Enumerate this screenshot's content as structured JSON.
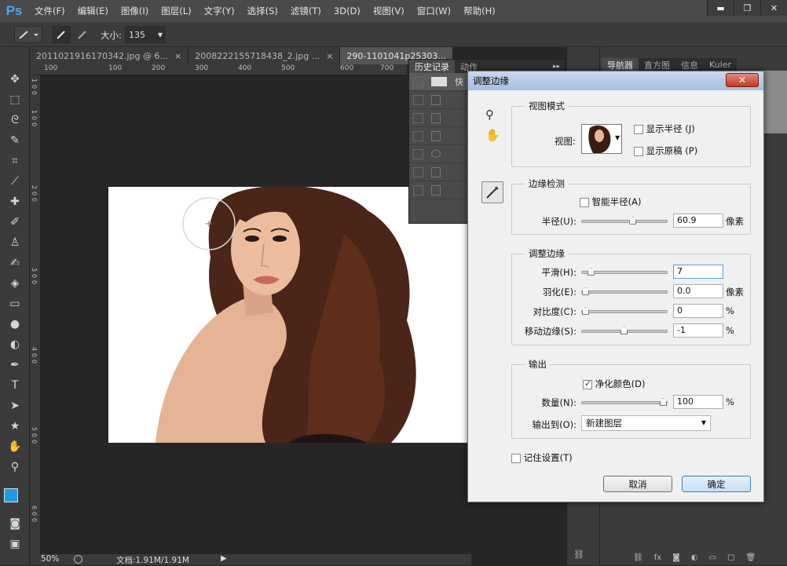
{
  "app": {
    "logo": "Ps"
  },
  "menu": [
    "文件(F)",
    "编辑(E)",
    "图像(I)",
    "图层(L)",
    "文字(Y)",
    "选择(S)",
    "滤镜(T)",
    "3D(D)",
    "视图(V)",
    "窗口(W)",
    "帮助(H)"
  ],
  "window_controls": {
    "minimize": "▬",
    "restore": "❐",
    "close": "✕"
  },
  "options": {
    "size_label": "大小:",
    "size_value": "135"
  },
  "tabs": [
    {
      "label": "2011021916170342.jpg @ 6...",
      "close": "×"
    },
    {
      "label": "2008222155718438_2.jpg ...",
      "close": "×"
    },
    {
      "label": "290-1101041p25303..."
    }
  ],
  "ruler_h": [
    "100",
    "100",
    "200",
    "300",
    "400",
    "500",
    "600",
    "700"
  ],
  "ruler_v": [
    "1",
    "0",
    "0",
    "1",
    "0",
    "0",
    "2",
    "0",
    "0",
    "3",
    "0",
    "0",
    "4",
    "0",
    "0",
    "5",
    "0",
    "0",
    "6",
    "0",
    "0"
  ],
  "status": {
    "zoom": "50%",
    "doc": "文档:1.91M/1.91M"
  },
  "history_panel": {
    "tabs": [
      "历史记录",
      "动作"
    ],
    "first_item": "快"
  },
  "right_panel": {
    "tabs": [
      "导航器",
      "直方图",
      "信息",
      "Kuler"
    ]
  },
  "dialog": {
    "title": "调整边缘",
    "close": "✕",
    "view_mode": {
      "title": "视图模式",
      "view_label": "视图:",
      "show_radius": "显示半径 (J)",
      "show_original": "显示原稿 (P)"
    },
    "edge_detection": {
      "title": "边缘检测",
      "smart_radius": "智能半径(A)",
      "radius_label": "半径(U):",
      "radius_value": "60.9",
      "radius_unit": "像素",
      "radius_level": 0.61
    },
    "adjust_edge": {
      "title": "调整边缘",
      "smooth_label": "平滑(H):",
      "smooth_value": "7",
      "smooth_level": 0.07,
      "feather_label": "羽化(E):",
      "feather_value": "0.0",
      "feather_unit": "像素",
      "feather_level": 0.0,
      "contrast_label": "对比度(C):",
      "contrast_value": "0",
      "contrast_unit": "%",
      "contrast_level": 0.0,
      "shift_label": "移动边缘(S):",
      "shift_value": "-1",
      "shift_unit": "%",
      "shift_level": 0.495
    },
    "output": {
      "title": "输出",
      "decontaminate": "净化颜色(D)",
      "amount_label": "数量(N):",
      "amount_value": "100",
      "amount_unit": "%",
      "amount_level": 1.0,
      "output_to_label": "输出到(O):",
      "output_to_value": "新建图层"
    },
    "remember": "记住设置(T)",
    "cancel": "取消",
    "ok": "确定"
  }
}
